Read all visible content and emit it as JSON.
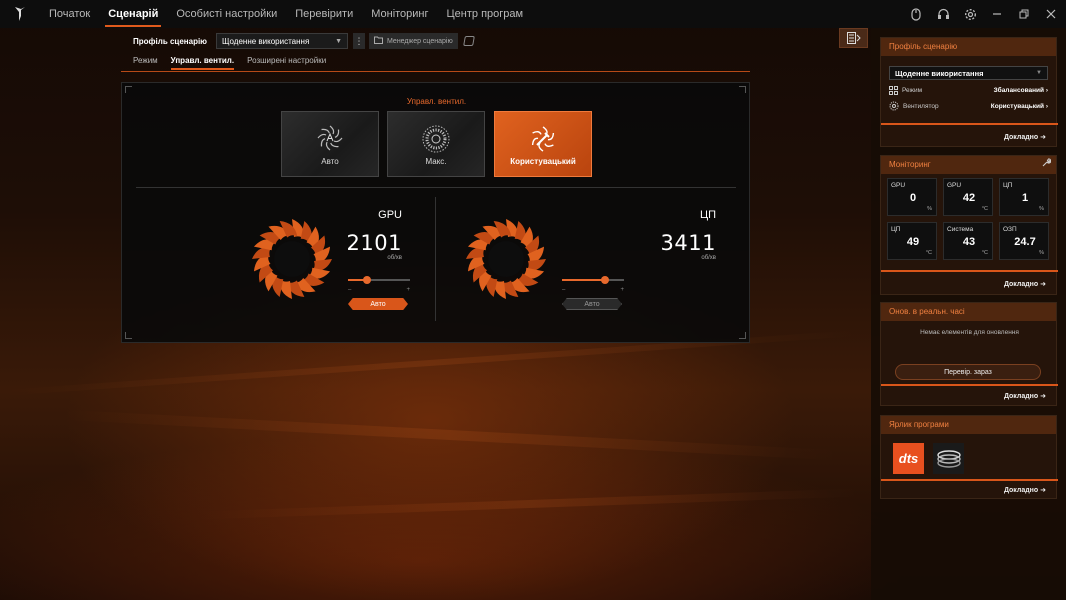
{
  "nav": {
    "items": [
      {
        "label": "Початок",
        "active": false
      },
      {
        "label": "Сценарій",
        "active": true
      },
      {
        "label": "Особисті настройки",
        "active": false
      },
      {
        "label": "Перевірити",
        "active": false
      },
      {
        "label": "Моніторинг",
        "active": false
      },
      {
        "label": "Центр програм",
        "active": false
      }
    ]
  },
  "window_icons": [
    "mouse-icon",
    "headset-icon",
    "settings-icon",
    "minimize-icon",
    "restore-icon",
    "close-icon"
  ],
  "profile": {
    "label": "Профіль сценарію",
    "selected": "Щоденне використання",
    "manager_label": "Менеджер сценарію"
  },
  "subtabs": [
    {
      "label": "Режим",
      "active": false
    },
    {
      "label": "Управл. вентил.",
      "active": true
    },
    {
      "label": "Розширені настройки",
      "active": false
    }
  ],
  "fan_control": {
    "title": "Управл. вентил.",
    "modes": [
      {
        "label": "Авто",
        "active": false,
        "icon": "fan-auto-icon"
      },
      {
        "label": "Макс.",
        "active": false,
        "icon": "fan-max-icon"
      },
      {
        "label": "Користувацький",
        "active": true,
        "icon": "fan-custom-icon"
      }
    ],
    "fans": [
      {
        "name": "GPU",
        "rpm": "2101",
        "unit": "об/хв",
        "slider_level": 0.3,
        "auto_label": "Авто",
        "auto_on": true,
        "min_mark": "–",
        "max_mark": "+"
      },
      {
        "name": "ЦП",
        "rpm": "3411",
        "unit": "об/хв",
        "slider_level": 0.7,
        "auto_label": "Авто",
        "auto_on": false,
        "min_mark": "–",
        "max_mark": "+"
      }
    ]
  },
  "sidebar": {
    "profile_card": {
      "title": "Профіль сценарію",
      "selected": "Щоденне використання",
      "rows": [
        {
          "key": "Режим",
          "value": "Збалансований",
          "icon": "mode-grid-icon"
        },
        {
          "key": "Вентилятор",
          "value": "Користувацький",
          "icon": "fan-icon"
        }
      ],
      "more": "Докладно"
    },
    "monitor_card": {
      "title": "Моніторинг",
      "cells": [
        {
          "label": "GPU",
          "value": "0",
          "unit": "%"
        },
        {
          "label": "GPU",
          "value": "42",
          "unit": "°C"
        },
        {
          "label": "ЦП",
          "value": "1",
          "unit": "%"
        },
        {
          "label": "ЦП",
          "value": "49",
          "unit": "°C"
        },
        {
          "label": "Система",
          "value": "43",
          "unit": "°C"
        },
        {
          "label": "ОЗП",
          "value": "24.7",
          "unit": "%"
        }
      ],
      "more": "Докладно"
    },
    "update_card": {
      "title": "Онов. в реальн. часі",
      "empty_text": "Немає елементів для оновлення",
      "button": "Перевір. зараз",
      "more": "Докладно"
    },
    "shortcut_card": {
      "title": "Ярлик програми",
      "apps": [
        "dts-icon",
        "app-disc-icon"
      ],
      "dts_text": "dts",
      "more": "Докладно"
    }
  },
  "colors": {
    "accent": "#e05a1c",
    "accent_light": "#e8692c"
  }
}
